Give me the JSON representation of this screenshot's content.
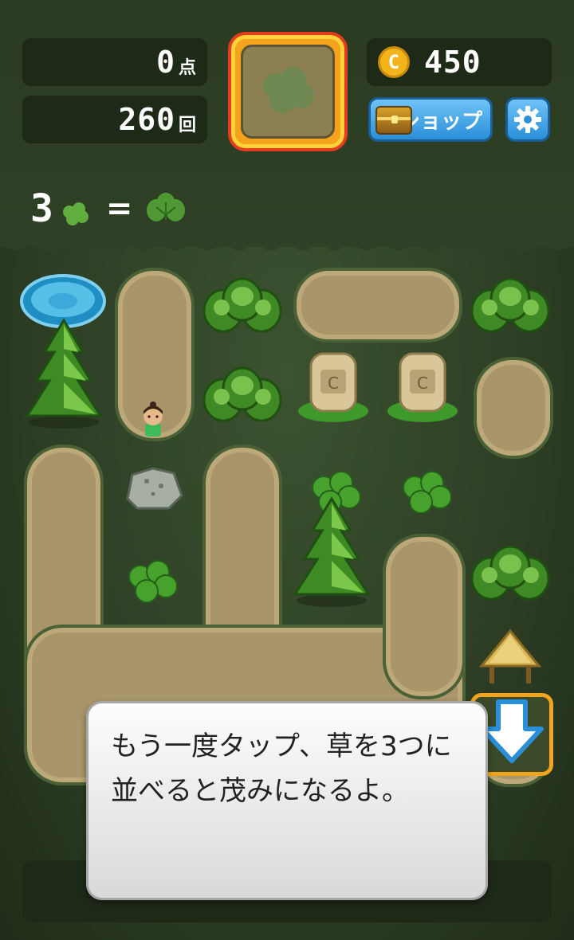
{
  "header": {
    "score_value": "0",
    "score_unit": "点",
    "moves_value": "260",
    "moves_unit": "回",
    "coin_value": "450",
    "coin_symbol": "C",
    "shop_label": "ショップ"
  },
  "recipe": {
    "count": "3",
    "equals": "=",
    "input_icon": "clover-icon",
    "output_icon": "bush-icon"
  },
  "next_item": {
    "icon": "clover-icon"
  },
  "board": {
    "items": [
      {
        "name": "pond-icon"
      },
      {
        "name": "pine-tree-icon"
      },
      {
        "name": "bush-icon"
      },
      {
        "name": "bush-icon"
      },
      {
        "name": "bush-icon"
      },
      {
        "name": "stone-statue-icon"
      },
      {
        "name": "stone-statue-icon"
      },
      {
        "name": "villager-icon"
      },
      {
        "name": "rock-icon"
      },
      {
        "name": "clover-icon"
      },
      {
        "name": "clover-icon"
      },
      {
        "name": "clover-icon"
      },
      {
        "name": "pine-tree-icon"
      },
      {
        "name": "bush-icon"
      },
      {
        "name": "hut-icon"
      },
      {
        "name": "down-arrow-icon"
      }
    ]
  },
  "dialog": {
    "text": "もう一度タップ、草を3つに並べると茂みになるよ。"
  },
  "colors": {
    "accent_orange": "#f4a31c",
    "button_blue": "#2a8fd7",
    "path_sand": "#a8956a"
  }
}
